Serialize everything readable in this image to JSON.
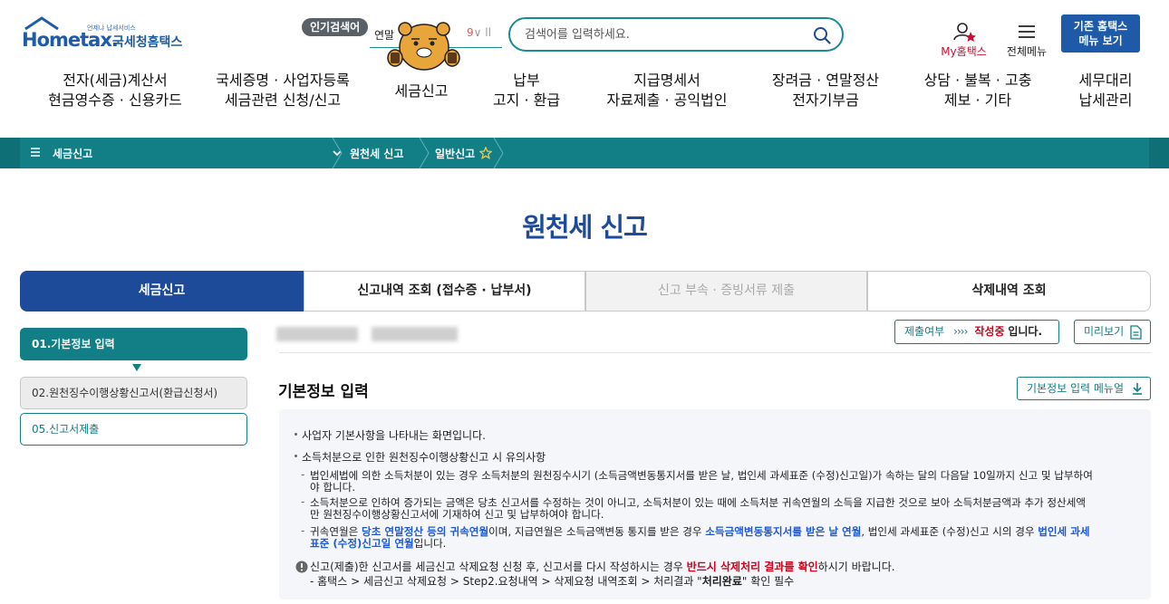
{
  "header": {
    "logo_small": "언제냐 납세서비스",
    "logo_main": "Hometax.",
    "logo_sub": "국세청홈택스",
    "popular_badge": "인기검색어",
    "popular_word": "연말",
    "popular_ctrl_1": "9",
    "popular_ctrl_2": "∨ ll",
    "search_placeholder": "검색어를 입력하세요.",
    "my_hometax": "My홈택스",
    "all_menu": "전체메뉴",
    "legacy_line1": "기존 홈택스",
    "legacy_line2": "메뉴 보기"
  },
  "gnb": [
    {
      "line1": "전자(세금)계산서",
      "line2": "현금영수증 · 신용카드"
    },
    {
      "line1": "국세증명 · 사업자등록",
      "line2": "세금관련 신청/신고"
    },
    {
      "line1": "세금신고",
      "line2": ""
    },
    {
      "line1": "납부",
      "line2": "고지 · 환급"
    },
    {
      "line1": "지급명세서",
      "line2": "자료제출 · 공익법인"
    },
    {
      "line1": "장려금 · 연말정산",
      "line2": "전자기부금"
    },
    {
      "line1": "상담 · 불복 · 고충",
      "line2": "제보 · 기타"
    },
    {
      "line1": "세무대리",
      "line2": "납세관리"
    }
  ],
  "breadcrumb": {
    "menu": "세금신고",
    "level2": "원천세 신고",
    "level3": "일반신고"
  },
  "page_title": "원천세 신고",
  "tabs": [
    {
      "label": "세금신고",
      "state": "active"
    },
    {
      "label": "신고내역 조회 (접수증 · 납부서)",
      "state": "normal"
    },
    {
      "label": "신고 부속 · 증빙서류 제출",
      "state": "disabled"
    },
    {
      "label": "삭제내역 조회",
      "state": "normal"
    }
  ],
  "steps": {
    "step1": "01.기본정보 입력",
    "step2": "02.원천징수이행상황신고서(환급신청서)",
    "step5": "05.신고서제출"
  },
  "status": {
    "label": "제출여부",
    "arrow": "››››",
    "value": "작성중",
    "tail": "입니다."
  },
  "preview_label": "미리보기",
  "section_title": "기본정보 입력",
  "manual_label": "기본정보 입력 메뉴얼",
  "notice": {
    "b1": "사업자 기본사항을 나타내는 화면입니다.",
    "b2": "소득처분으로 인한 원천징수이행상황신고 시 유의사항",
    "d1_l1": "법인세법에 의한 소득처분이 있는 경우 소득처분의 원천징수시기 (소득금액변동통지서를 받은 날, 법인세 과세표준 (수정)신고일)가 속하는 달의 다음달 10일까지 신고 및 납부하여",
    "d1_l2": "야 합니다.",
    "d2_l1": "소득처분으로 인하여 증가되는 금액은 당초 신고서를 수정하는 것이 아니고, 소득처분이 있는 때에 소득처분 귀속연월의 소득을 지급한 것으로 보아 소득처분금액과 추가 정산세액",
    "d2_l2": "만 원천징수이행상황신고서에 기재하여 신고 및 납부하여야 합니다.",
    "d3_a": "귀속연월은 ",
    "d3_b": "당초 연말정산 등의 귀속연월",
    "d3_c": "이며, 지급연월은 소득금액변동 통지를 받은 경우 ",
    "d3_d": "소득금액변동통지서를 받은 날 연월",
    "d3_e": ", 법인세 과세표준 (수정)신고 시의 경우 ",
    "d3_f": "법인세 과세",
    "d3_g": "표준 (수정)신고일 연월",
    "d3_h": "입니다.",
    "w_a": "신고(제출)한 신고서를 세금신고 삭제요청 신청 후, 신고서를 다시 작성하시는 경우 ",
    "w_b": "반드시 삭제처리 결과를 확인",
    "w_c": "하시기 바랍니다.",
    "w2_a": "- 홈택스 > 세금신고 삭제요청 > Step2.요청내역 > 삭제요청 내역조회 > 처리결과 \"",
    "w2_b": "처리완료",
    "w2_c": "\" 확인 필수"
  },
  "colors": {
    "teal": "#127f86",
    "navy": "#1e4a9a",
    "red": "#d0021b",
    "blue_highlight": "#1e5ad7"
  }
}
